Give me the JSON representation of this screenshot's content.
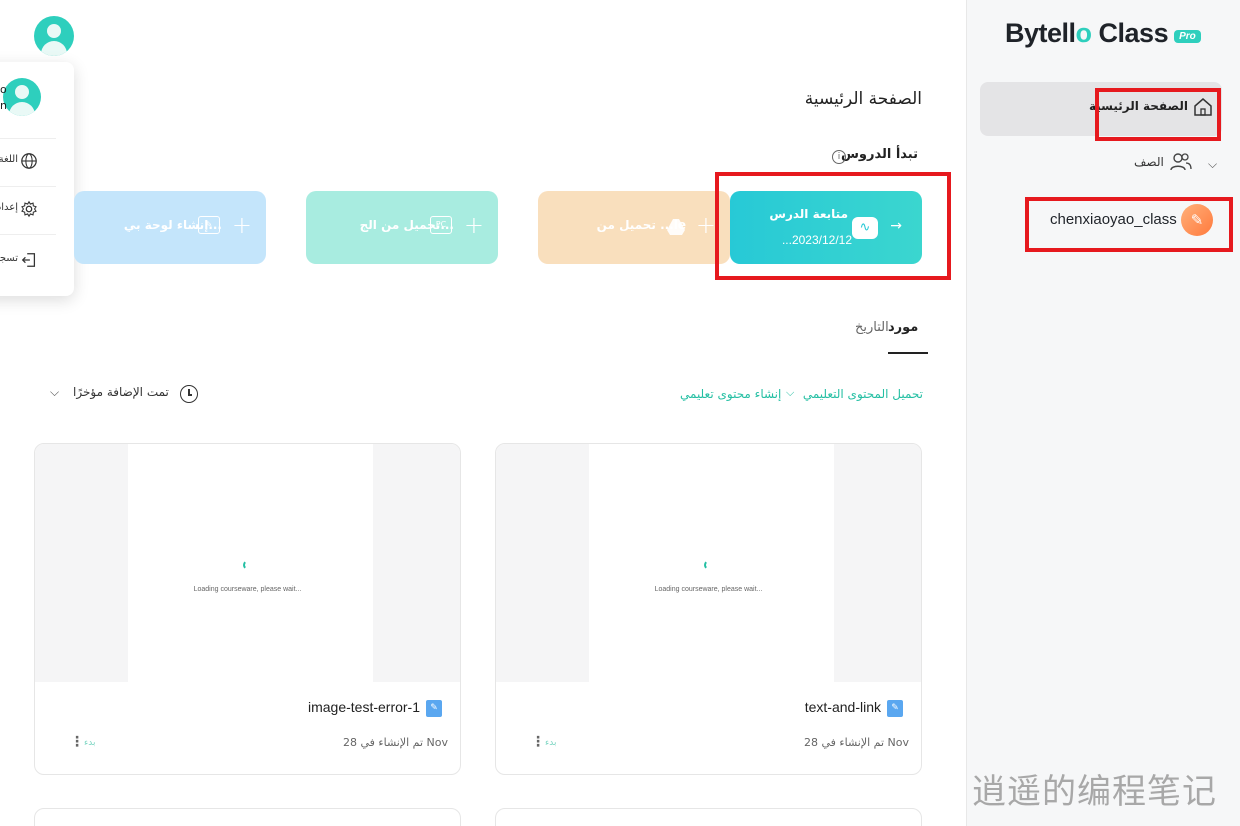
{
  "app": {
    "brand_main": "Bytell",
    "brand_o": "o",
    "brand_suffix": " Class",
    "pro_badge": "Pro"
  },
  "sidebar": {
    "home_label": "الصفحة الرئيسية",
    "class_label": "الصف",
    "class_item": "chenxiaoyao_class"
  },
  "user_menu": {
    "line1": "o",
    "line2": "n",
    "items": [
      {
        "label": "اللغة",
        "icon": "globe-icon"
      },
      {
        "label": "إعدادات",
        "icon": "gear-icon"
      },
      {
        "label": "تسجيل",
        "icon": "logout-icon"
      }
    ]
  },
  "main": {
    "page_title": "الصفحة الرئيسية",
    "section_title": "تبدأ الدروس",
    "info_glyph": "i",
    "cards": {
      "continue_title": "متابعة الدرس",
      "continue_date": "...2023/12/12",
      "drive": "تحميل من ...le",
      "pc": "تحميل من الج...",
      "board": "إنشاء لوحة بي..."
    },
    "tabs": {
      "active": "مورد",
      "history": "التاريخ"
    },
    "upload_link": "تحميل المحتوى التعليمي",
    "create_link": "إنشاء محتوى تعليمي",
    "sort_label": "تمت الإضافة مؤخرًا",
    "resources": [
      {
        "name": "text-and-link",
        "date": "تم الإنشاء في 28 Nov",
        "start": "بدء",
        "loading": "Loading courseware, please wait..."
      },
      {
        "name": "image-test-error-1",
        "date": "تم الإنشاء في 28 Nov",
        "start": "بدء",
        "loading": "Loading courseware, please wait..."
      }
    ]
  },
  "watermark": "逍遥的编程笔记",
  "colors": {
    "accent": "#24bfa3",
    "highlight": "#e6191e",
    "continue_card": "#27c9d6"
  }
}
